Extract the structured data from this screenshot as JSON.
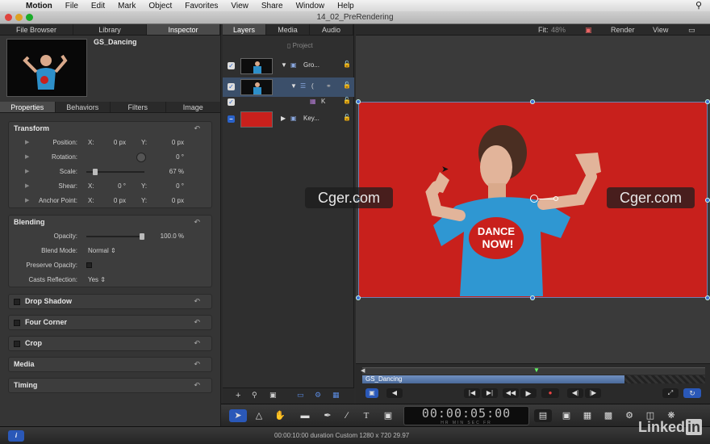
{
  "menubar": {
    "app": "Motion",
    "items": [
      "File",
      "Edit",
      "Mark",
      "Object",
      "Favorites",
      "View",
      "Share",
      "Window",
      "Help"
    ]
  },
  "window": {
    "title": "14_02_PreRendering"
  },
  "left": {
    "tabs": [
      "File Browser",
      "Library",
      "Inspector"
    ],
    "preview_name": "GS_Dancing",
    "subtabs": [
      "Properties",
      "Behaviors",
      "Filters",
      "Image"
    ],
    "transform": {
      "title": "Transform",
      "position": {
        "label": "Position:",
        "x_label": "X:",
        "x": "0 px",
        "y_label": "Y:",
        "y": "0 px"
      },
      "rotation": {
        "label": "Rotation:",
        "value": "0 °"
      },
      "scale": {
        "label": "Scale:",
        "value": "67 %",
        "level": 0.12
      },
      "shear": {
        "label": "Shear:",
        "x_label": "X:",
        "x": "0 °",
        "y_label": "Y:",
        "y": "0 °"
      },
      "anchor": {
        "label": "Anchor Point:",
        "x_label": "X:",
        "x": "0 px",
        "y_label": "Y:",
        "y": "0 px"
      }
    },
    "blending": {
      "title": "Blending",
      "opacity": {
        "label": "Opacity:",
        "value": "100.0 %",
        "level": 1.0
      },
      "blend_mode": {
        "label": "Blend Mode:",
        "value": "Normal"
      },
      "preserve_opacity": {
        "label": "Preserve Opacity:"
      },
      "casts_reflection": {
        "label": "Casts Reflection:",
        "value": "Yes"
      }
    },
    "collapsed_groups": [
      "Drop Shadow",
      "Four Corner",
      "Crop",
      "Media",
      "Timing"
    ]
  },
  "layers": {
    "tabs": [
      "Layers",
      "Media",
      "Audio"
    ],
    "project_label": "Project",
    "rows": [
      {
        "name": "Gro...",
        "checked": true
      },
      {
        "name": "(",
        "checked": true
      },
      {
        "name": "K",
        "checked": true
      },
      {
        "name": "Key...",
        "checked": false
      }
    ]
  },
  "canvas": {
    "fit_label": "Fit:",
    "fit_value": "48%",
    "render_label": "Render",
    "view_label": "View",
    "watermark": "Cger.com",
    "shirt_text_1": "DANCE",
    "shirt_text_2": "NOW!"
  },
  "timeline": {
    "clip_name": "GS_Dancing"
  },
  "toolbar": {
    "timecode": "00:00:05:00",
    "units": "HR MIN SEC FR"
  },
  "status": {
    "info": "i",
    "text": "00:00:10:00 duration Custom 1280 x 720 29.97"
  },
  "watermark_brand": "Linked",
  "watermark_brand_in": "in",
  "colors": {
    "canvas_red": "#c8201c",
    "selection": "#3b4f6a",
    "accent_blue": "#2a58b8"
  }
}
